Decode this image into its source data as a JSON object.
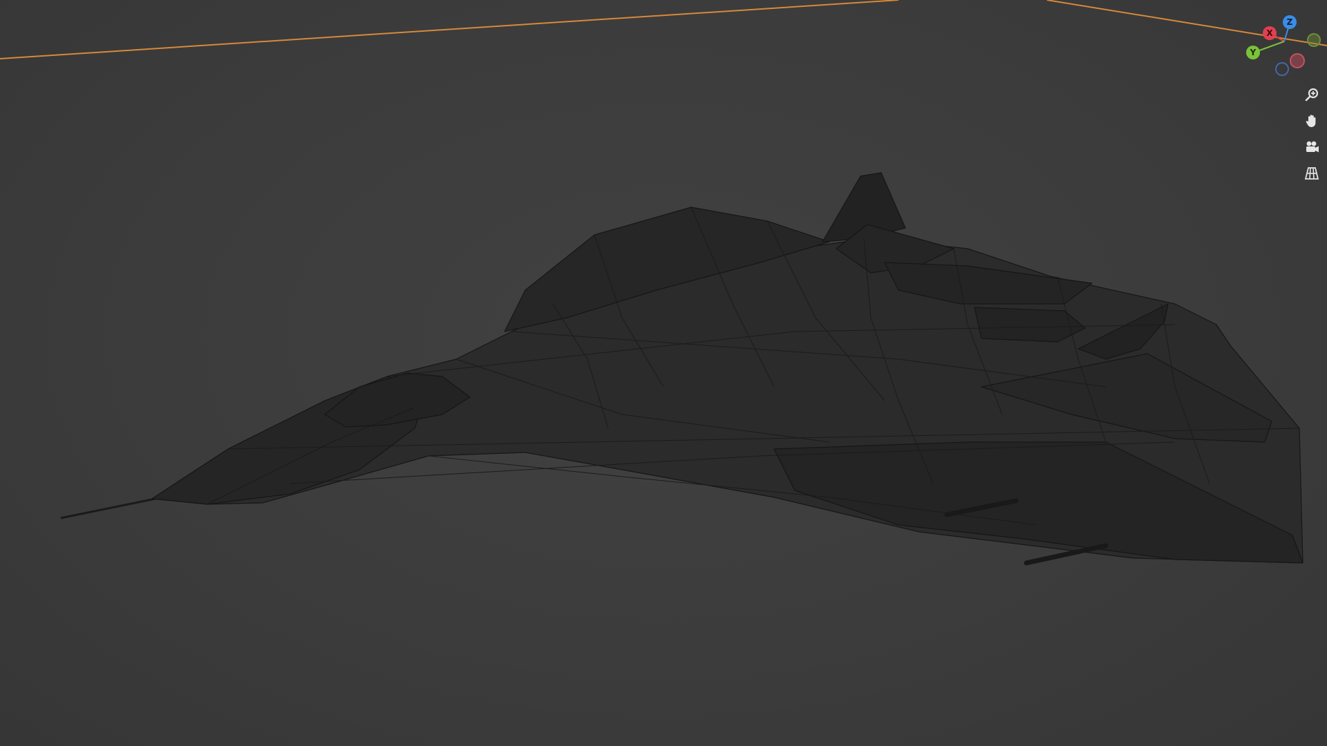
{
  "viewport": {
    "background": "#3d3d3d",
    "wire_color": "#1e1e1e",
    "axis_line_color": "#e8922a"
  },
  "gizmo": {
    "x_label": "X",
    "y_label": "Y",
    "z_label": "Z",
    "x_color": "#e0404f",
    "y_color": "#7bc23a",
    "z_color": "#3a8ce8",
    "neg_x_color": "#c85060",
    "neg_y_color": "#6f8f3a",
    "neg_z_color": "#4466aa"
  },
  "nav_tools": [
    {
      "icon": "zoom-icon"
    },
    {
      "icon": "hand-pan-icon"
    },
    {
      "icon": "camera-icon"
    },
    {
      "icon": "perspective-grid-icon"
    }
  ]
}
